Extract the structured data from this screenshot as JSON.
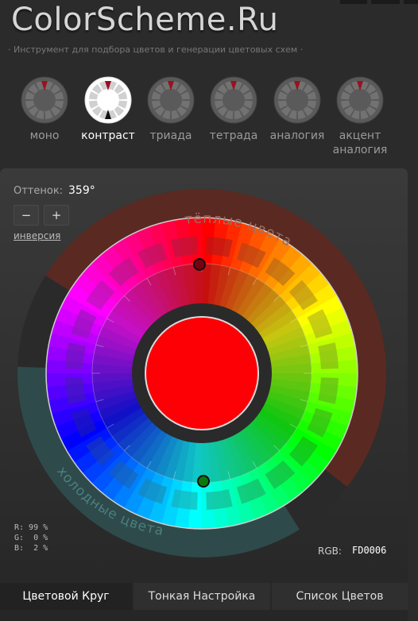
{
  "header": {
    "logo_text": "ColorScheme.Ru",
    "tagline": "· Инструмент для подбора цветов и генерации цветовых схем ·"
  },
  "scheme_tabs": [
    {
      "id": "mono",
      "label": "моно",
      "active": false
    },
    {
      "id": "contrast",
      "label": "контраст",
      "active": true
    },
    {
      "id": "triad",
      "label": "триада",
      "active": false
    },
    {
      "id": "tetrad",
      "label": "тетрада",
      "active": false
    },
    {
      "id": "analogy",
      "label": "аналогия",
      "active": false
    },
    {
      "id": "accent",
      "label": "акцент аналогия",
      "line1": "акцент",
      "line2": "аналогия",
      "active": false
    }
  ],
  "controls": {
    "hue_label": "Оттенок:",
    "hue_value": "359°",
    "minus_label": "−",
    "plus_label": "+",
    "inversion_label": "инверсия"
  },
  "wheel": {
    "warm_label": "тёплые цвета",
    "cold_label": "холодные цвета",
    "center_color": "#FD0006"
  },
  "rgb": {
    "r_line": "R: 99 %",
    "g_line": "G:  0 %",
    "b_line": "B:  2 %",
    "label": "RGB:",
    "value": "FD0006"
  },
  "bottom_tabs": [
    {
      "label": "Цветовой Круг",
      "active": true
    },
    {
      "label": "Тонкая Настройка",
      "active": false
    },
    {
      "label": "Список Цветов",
      "active": false
    }
  ]
}
